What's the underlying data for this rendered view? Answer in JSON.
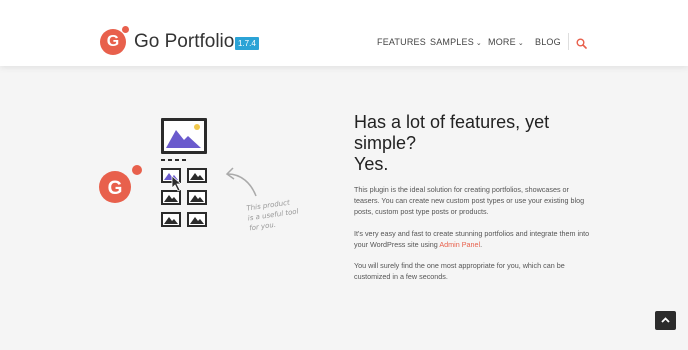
{
  "header": {
    "logo_letter": "G",
    "brand": "Go Portfolio",
    "version": "1.7.4",
    "nav": [
      "FEATURES",
      "SAMPLES",
      "MORE",
      "BLOG"
    ],
    "search_icon": "search-icon",
    "accent_color": "#e8604c",
    "version_color": "#2ba3d6"
  },
  "hero": {
    "title_line1": "Has a lot of features, yet",
    "title_line2": "simple?",
    "title_line3": "Yes.",
    "para1": "This plugin is the ideal solution for creating portfolios, showcases or teasers. You can create new custom post types or use your existing blog posts, custom post type posts or products.",
    "para2_before": "It's very easy and fast to create stunning portfolios and integrate them into your WordPress site using ",
    "para2_link": "Admin Panel",
    "para2_after": ".",
    "para3": "You will surely find the one most appropriate for you, which can be customized in a few seconds."
  },
  "illustration": {
    "logo_letter": "G",
    "handwritten_line1": "This product",
    "handwritten_line2": "is a useful tool",
    "handwritten_line3": "for you."
  },
  "scroll_top_icon": "chevron-up-icon"
}
